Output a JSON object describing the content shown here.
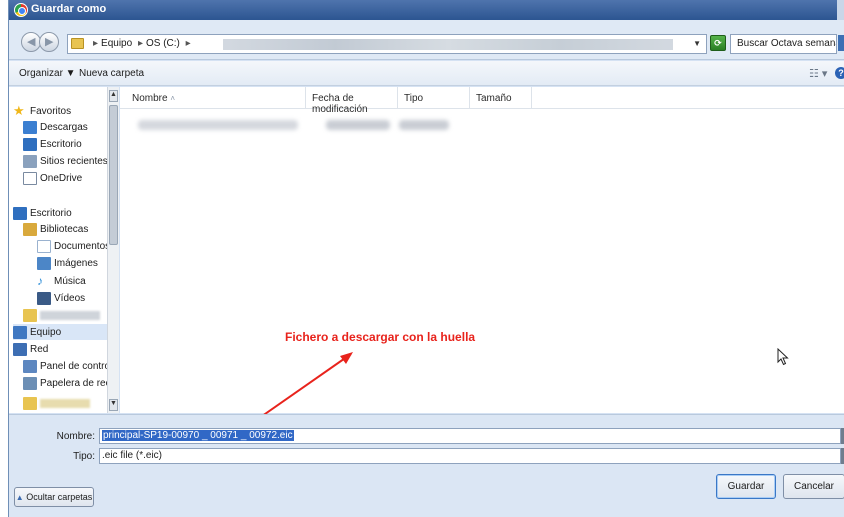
{
  "titlebar": {
    "title": "Guardar como"
  },
  "address": {
    "crumbs": [
      "Equipo",
      "OS (C:)"
    ]
  },
  "search": {
    "placeholder": "Buscar Octava semana"
  },
  "toolbar": {
    "organize_label": "Organizar ▼",
    "new_folder_label": "Nueva carpeta"
  },
  "navpane": {
    "items": [
      {
        "label": "Favoritos",
        "icon": "star-icon",
        "color": "#f0b71a"
      },
      {
        "label": "Descargas",
        "icon": "downloads-folder-icon",
        "color": "#3b7fd1"
      },
      {
        "label": "Escritorio",
        "icon": "desktop-icon",
        "color": "#2f6fbf"
      },
      {
        "label": "Sitios recientes",
        "icon": "recent-places-icon",
        "color": "#8aa1bd"
      },
      {
        "label": "OneDrive",
        "icon": "onedrive-icon",
        "color": "#7a8aa0"
      },
      {
        "label": "Escritorio",
        "icon": "desktop-icon",
        "color": "#2f6fbf"
      },
      {
        "label": "Bibliotecas",
        "icon": "libraries-icon",
        "color": "#d9a93c"
      },
      {
        "label": "Documentos",
        "icon": "documents-icon",
        "color": "#9ab2cf"
      },
      {
        "label": "Imágenes",
        "icon": "pictures-icon",
        "color": "#4c86c7"
      },
      {
        "label": "Música",
        "icon": "music-icon",
        "color": "#2f8fd8"
      },
      {
        "label": "Vídeos",
        "icon": "videos-icon",
        "color": "#3a5a86"
      },
      {
        "label": "Equipo",
        "icon": "computer-icon",
        "color": "#3f78c2"
      },
      {
        "label": "Red",
        "icon": "network-icon",
        "color": "#3d6eb3"
      },
      {
        "label": "Panel de control",
        "icon": "control-panel-icon",
        "color": "#5d87c0"
      },
      {
        "label": "Papelera de recicla",
        "icon": "recycle-bin-icon",
        "color": "#6c8fb5"
      }
    ]
  },
  "columns": {
    "name": "Nombre",
    "date": "Fecha de modificación",
    "type": "Tipo",
    "size": "Tamaño"
  },
  "annotation": {
    "text": "Fichero a descargar con la huella",
    "color": "#e8231c"
  },
  "bottom": {
    "name_label": "Nombre:",
    "filename": "principal-SP19-00970 _ 00971 _ 00972.eic",
    "type_label": "Tipo:",
    "filetype": ".eic file (*.eic)",
    "hide_folders_label": "Ocultar carpetas",
    "save_label": "Guardar",
    "cancel_label": "Cancelar"
  }
}
